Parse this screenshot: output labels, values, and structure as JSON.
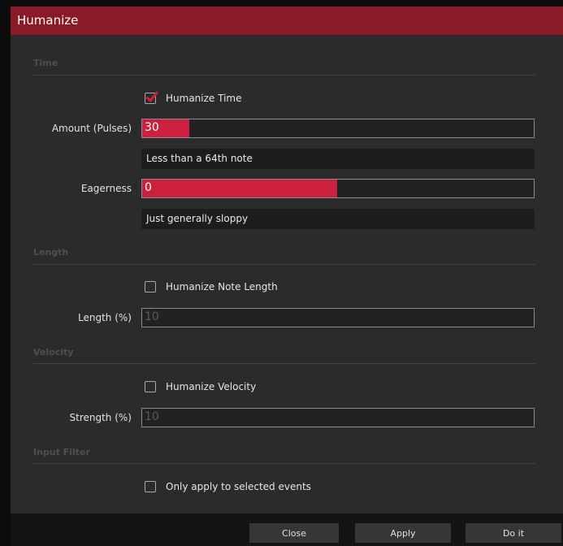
{
  "window": {
    "title": "Humanize"
  },
  "sections": {
    "time": "Time",
    "length": "Length",
    "velocity": "Velocity",
    "input_filter": "Input Filter"
  },
  "time": {
    "humanize_label": "Humanize Time",
    "humanize_checked": true,
    "amount_label": "Amount (Pulses)",
    "amount_value": "30",
    "amount_fill": 0.12,
    "amount_info": "Less than a 64th note",
    "eagerness_label": "Eagerness",
    "eagerness_value": "0",
    "eagerness_fill": 0.5,
    "eagerness_info": "Just generally sloppy"
  },
  "length": {
    "humanize_label": "Humanize Note Length",
    "humanize_checked": false,
    "length_label": "Length (%)",
    "length_value": "10"
  },
  "velocity": {
    "humanize_label": "Humanize Velocity",
    "humanize_checked": false,
    "strength_label": "Strength (%)",
    "strength_value": "10"
  },
  "input_filter": {
    "selected_only_label": "Only apply to selected events",
    "selected_only_checked": false
  },
  "buttons": {
    "close": "Close",
    "apply": "Apply",
    "do_it": "Do it"
  },
  "colors": {
    "title_bar": "#8a1b26",
    "accent": "#cd1f3e",
    "background": "#2b2b2d"
  }
}
